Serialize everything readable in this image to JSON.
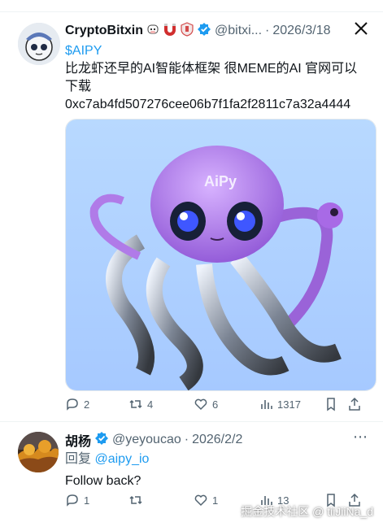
{
  "top": {
    "metrics": [
      "▢",
      "◯",
      "▢",
      "▢",
      "▢"
    ]
  },
  "tweet1": {
    "author": "CryptoBitxin",
    "handle": "@bitxi...",
    "separator": "·",
    "date": "2026/3/18",
    "ticker": "$AIPY",
    "line1": "比龙虾还早的AI智能体框架 很MEME的AI 官网可以",
    "line2": "下载",
    "line3": "0xc7ab4fd507276cee06b7f1fa2f2811c7a32a4444",
    "image_label": "AiPy",
    "actions": {
      "reply": "2",
      "retweet": "4",
      "like": "6",
      "views": "1317"
    }
  },
  "tweet2": {
    "author": "胡杨",
    "handle": "@yeyoucao",
    "separator": "·",
    "date": "2026/2/2",
    "reply_prefix": "回复",
    "reply_to": "@aipy_io",
    "text": "Follow back?",
    "actions": {
      "reply": "1",
      "retweet": "",
      "like": "1",
      "views": "13"
    }
  },
  "watermark": "掘金技术社区 @ tiiJiiNa_d",
  "colors": {
    "accent": "#1d9bf0",
    "muted": "#536471",
    "border": "#eff3f4"
  }
}
